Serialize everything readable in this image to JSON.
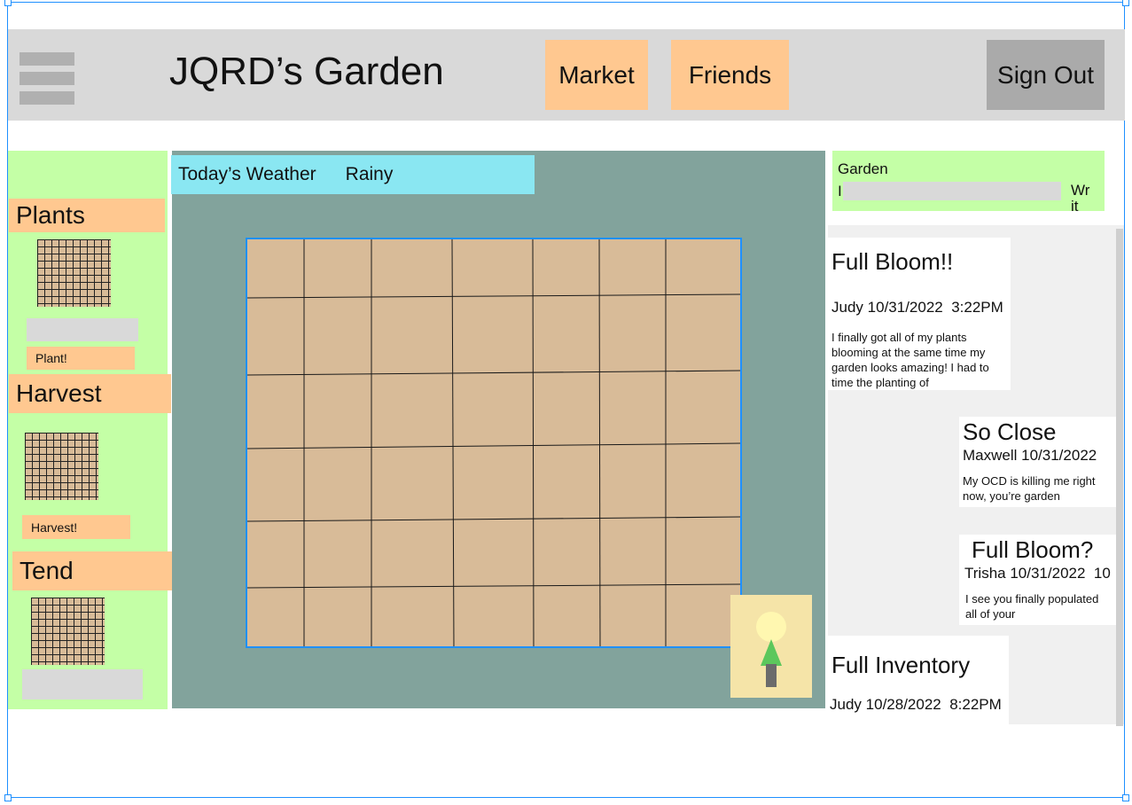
{
  "header": {
    "title": "JQRD’s Garden",
    "nav": {
      "market": "Market",
      "friends": "Friends"
    },
    "sign_out": "Sign Out"
  },
  "sidebar": {
    "plants": {
      "label": "Plants",
      "button": "Plant!"
    },
    "harvest": {
      "label": "Harvest",
      "button": "Harvest!"
    },
    "tend": {
      "label": "Tend"
    }
  },
  "weather": {
    "label": "Today’s Weather",
    "value": "Rainy"
  },
  "compose": {
    "label": "Garden",
    "cursor": "I",
    "write": "Writ"
  },
  "posts": [
    {
      "title": "Full Bloom!!",
      "author": "Judy",
      "date": "10/31/2022",
      "time": "3:22PM",
      "body": "I finally got all of my plants blooming at the same time my garden looks amazing! I had to time the planting of"
    },
    {
      "title": "So Close",
      "author": "Maxwell",
      "date": "10/31/2022",
      "time": "",
      "body": "My OCD is killing me right now, you’re garden"
    },
    {
      "title": "Full Bloom?",
      "author": "Trisha",
      "date": "10/31/2022",
      "time": "10",
      "body": "I see you finally populated all of your"
    },
    {
      "title": "Full Inventory",
      "author": "Judy",
      "date": "10/28/2022",
      "time": "8:22PM",
      "body": ""
    }
  ],
  "colors": {
    "header_bg": "#d9d9d9",
    "nav_button": "#ffc890",
    "sign_out_bg": "#aaaaaa",
    "panel_green": "#c4ffa6",
    "garden_bg": "#82a39c",
    "soil": "#d8bb98",
    "weather_bg": "#8ae7f2",
    "selection_blue": "#1e90ff"
  },
  "icons": {
    "menu": "hamburger-menu-icon",
    "tree": "tree-icon"
  }
}
